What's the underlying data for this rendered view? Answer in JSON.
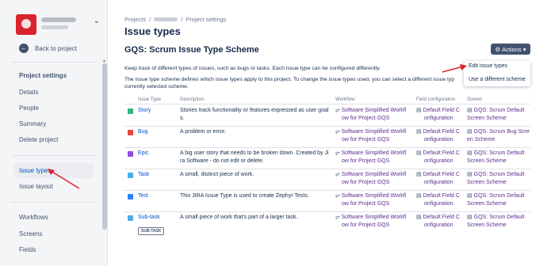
{
  "sidebar": {
    "back_label": "Back to project",
    "section_title": "Project settings",
    "items": [
      "Details",
      "People",
      "Summary",
      "Delete project",
      "Issue types",
      "Issue layout",
      "Workflows",
      "Screens",
      "Fields"
    ]
  },
  "breadcrumb": {
    "projects": "Projects",
    "sep1": "/",
    "sep2": "/",
    "settings": "Project settings"
  },
  "page_title": "Issue types",
  "scheme_title": "GQS: Scrum Issue Type Scheme",
  "actions_label": "Actions",
  "desc1": "Keep track of different types of issues, such as bugs or tasks. Each issue type can be configured differently.",
  "desc2": "The issue type scheme defines which issue types apply to this project. To change the issue types used, you can select a different issue typ",
  "desc3": "currently selected scheme.",
  "dropdown": {
    "item1": "Edit issue types",
    "item2": "Use a different scheme"
  },
  "table": {
    "headers": [
      "Issue Type",
      "Description",
      "Workflow",
      "Field configuration",
      "Screen"
    ],
    "rows": [
      {
        "name": "Story",
        "color": "#36b37e",
        "desc1": "Stories track functionality or features expressed as user goal",
        "desc2": "s.",
        "wf1": "Software Simplified Workfl",
        "wf2": "ow for Project GQS",
        "fc1": "Default Field C",
        "fc2": "onfiguration",
        "sc1": "GQS: Scrum Default",
        "sc2": "Screen Scheme"
      },
      {
        "name": "Bug",
        "color": "#e5493a",
        "desc1": "A problem or error.",
        "desc2": "",
        "wf1": "Software Simplified Workfl",
        "wf2": "ow for Project GQS",
        "fc1": "Default Field C",
        "fc2": "onfiguration",
        "sc1": "GQS: Scrum Bug Scre",
        "sc2": "en Scheme"
      },
      {
        "name": "Epic",
        "color": "#904ee2",
        "desc1": "A big user story that needs to be broken down. Created by Ji",
        "desc2": "ra Software - do not edit or delete.",
        "wf1": "Software Simplified Workfl",
        "wf2": "ow for Project GQS",
        "fc1": "Default Field C",
        "fc2": "onfiguration",
        "sc1": "GQS: Scrum Default",
        "sc2": "Screen Scheme"
      },
      {
        "name": "Task",
        "color": "#4bade8",
        "desc1": "A small, distinct piece of work.",
        "desc2": "",
        "wf1": "Software Simplified Workfl",
        "wf2": "ow for Project GQS",
        "fc1": "Default Field C",
        "fc2": "onfiguration",
        "sc1": "GQS: Scrum Default",
        "sc2": "Screen Scheme"
      },
      {
        "name": "Test",
        "color": "#2684ff",
        "desc1": "This JIRA Issue Type is used to create Zephyr Tests.",
        "desc2": "",
        "wf1": "Software Simplified Workfl",
        "wf2": "ow for Project GQS",
        "fc1": "Default Field C",
        "fc2": "onfiguration",
        "sc1": "GQS: Scrum Default",
        "sc2": "Screen Scheme"
      },
      {
        "name": "Sub-task",
        "color": "#4bade8",
        "desc1": "A small piece of work that's part of a larger task.",
        "desc2": "",
        "wf1": "Software Simplified Workfl",
        "wf2": "ow for Project GQS",
        "fc1": "Default Field C",
        "fc2": "onfiguration",
        "sc1": "GQS: Scrum Default",
        "sc2": "Screen Scheme"
      }
    ],
    "subtask_badge": "SUB-TASK"
  },
  "annotation_color": "#d9232e"
}
